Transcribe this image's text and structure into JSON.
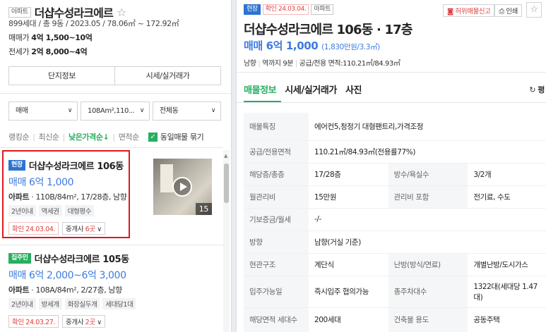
{
  "left": {
    "type_tag": "아파트",
    "complex_name": "더샵수성라크에르",
    "star": "☆",
    "summary": "899세대 / 총 9동 / 2023.05 / 78.06㎡ ~ 172.92㎡",
    "sale_label": "매매가",
    "sale_value": "4억 1,500~10억",
    "lease_label": "전세가",
    "lease_value": "2억 8,000~4억",
    "tab_info": "단지정보",
    "tab_price": "시세/실거래가",
    "filter_deal": "매매",
    "filter_area": "108Am²,110...",
    "filter_type": "전체동",
    "sorts": [
      "랭킹순",
      "최신순",
      "낮은가격순↓",
      "면적순"
    ],
    "same_label": "동일매물 묶기",
    "listings": [
      {
        "badge": "현장",
        "title": "더샵수성라크에르 106동",
        "price": "매매 6억 1,000",
        "type": "아파트",
        "detail": " · 110B/84m², 17/28층, 남향",
        "keywords": [
          "2년이내",
          "역세권",
          "대형평수"
        ],
        "confirm": "확인 24.03.04.",
        "agent_pre": "중개사 ",
        "agent_num": "6곳",
        "photo_count": "15"
      },
      {
        "badge": "집주인",
        "title": "더샵수성라크에르 105동",
        "price": "매매 6억 2,000~6억 3,000",
        "type": "아파트",
        "detail": " · 108A/84m², 2/27층, 남향",
        "keywords": [
          "2년이내",
          "방세개",
          "화장실두개",
          "세대당1대"
        ],
        "confirm": "확인 24.03.27.",
        "agent_pre": "중개사 ",
        "agent_num": "2곳"
      }
    ]
  },
  "right": {
    "tag1": "현장",
    "tag2": "확인 24.03.04.",
    "tag3": "아파트",
    "btn_report": "허위매물신고",
    "btn_print": "인쇄",
    "star": "☆",
    "title": "더샵수성라크에르 106동 · 17층",
    "price": "매매 6억 1,000",
    "price_unit": "(1,830만원/3.3㎡)",
    "info": [
      "남향",
      "역까지 9분",
      "공급/전용 면적:110.21㎡/84.93㎡"
    ],
    "tabs": [
      "매물정보",
      "시세/실거래가",
      "사진"
    ],
    "refresh": "평",
    "rows": [
      {
        "k": "매물특징",
        "v": "에어컨5,청정기 대형팬트리,가격조정"
      },
      {
        "k": "공급/전용면적",
        "v": "110.21㎡/84.93㎡(전용률77%)"
      },
      {
        "k": "해당층/총층",
        "v": "17/28층",
        "k2": "방수/욕실수",
        "v2": "3/2개"
      },
      {
        "k": "월관리비",
        "v": "15만원",
        "k2": "관리비 포함",
        "v2": "전기료, 수도"
      },
      {
        "k": "기보증금/월세",
        "v": "-/-"
      },
      {
        "k": "방향",
        "v": "남향(거실 기준)"
      },
      {
        "k": "현관구조",
        "v": "계단식",
        "k2": "난방(방식/연료)",
        "v2": "개별난방/도시가스"
      },
      {
        "k": "입주가능일",
        "v": "즉시입주 협의가능",
        "k2": "총주차대수",
        "v2": "1322대(세대당 1.47대)"
      },
      {
        "k": "해당면적 세대수",
        "v": "200세대",
        "k2": "건축물 용도",
        "v2": "공동주택"
      }
    ]
  }
}
